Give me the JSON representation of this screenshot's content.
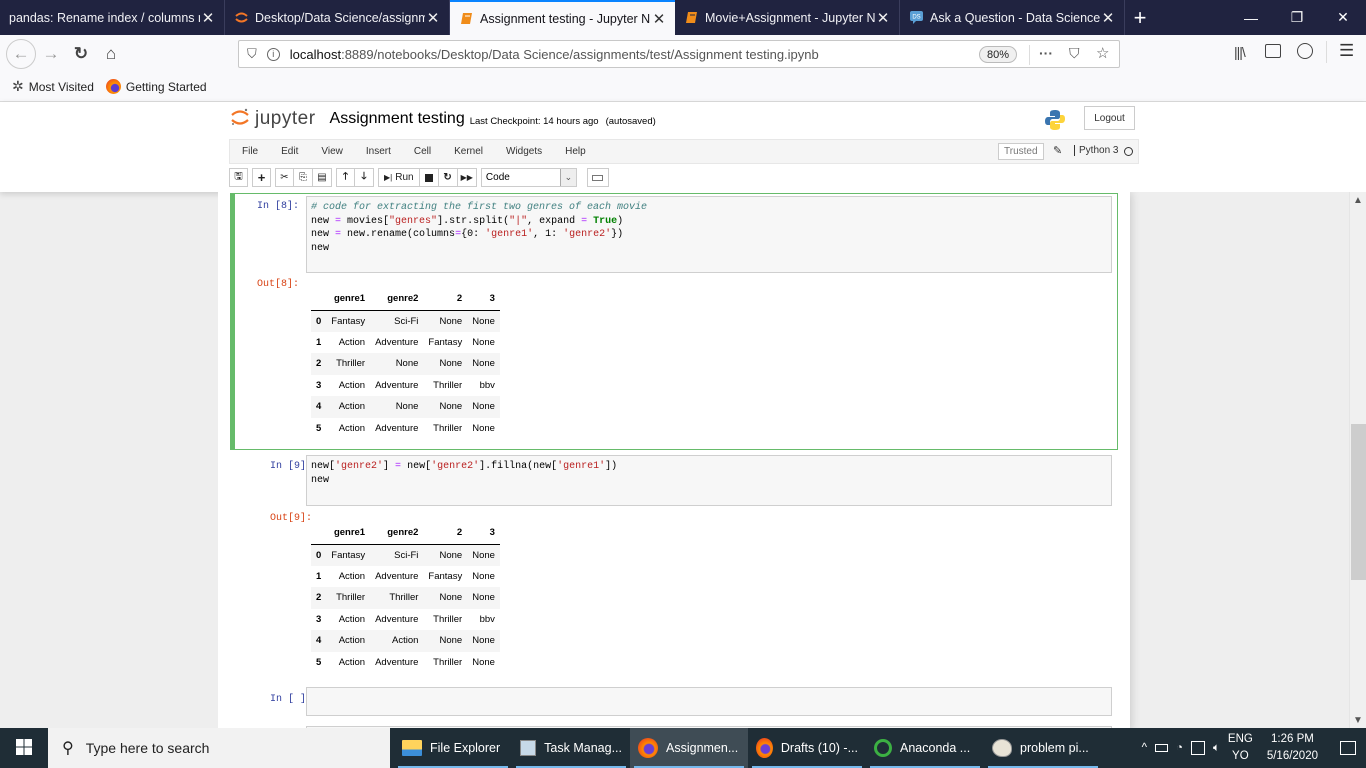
{
  "browser": {
    "tabs": [
      {
        "title": "pandas: Rename index / columns n",
        "icon": "generic-page-icon",
        "active": false
      },
      {
        "title": "Desktop/Data Science/assignm",
        "icon": "jupyter-icon",
        "active": false
      },
      {
        "title": "Assignment testing - Jupyter N",
        "icon": "notebook-icon",
        "active": true
      },
      {
        "title": "Movie+Assignment - Jupyter N",
        "icon": "notebook-icon",
        "active": false
      },
      {
        "title": "Ask a Question - Data Science S",
        "icon": "ds-icon",
        "active": false
      }
    ],
    "new_tab": "+",
    "url_host": "localhost",
    "url_rest": ":8889/notebooks/Desktop/Data Science/assignments/test/Assignment testing.ipynb",
    "zoom_level": "80%",
    "bookmarks": [
      {
        "label": "Most Visited",
        "icon": "gear-icon"
      },
      {
        "label": "Getting Started",
        "icon": "firefox-icon"
      }
    ]
  },
  "jupyter": {
    "logo_text": "jupyter",
    "notebook_name": "Assignment testing",
    "checkpoint": "Last Checkpoint: 14 hours ago",
    "autosaved": "(autosaved)",
    "logout": "Logout",
    "menu": [
      "File",
      "Edit",
      "View",
      "Insert",
      "Cell",
      "Kernel",
      "Widgets",
      "Help"
    ],
    "trusted": "Trusted",
    "kernel_name": "Python 3",
    "run_label": "Run",
    "cell_type": "Code"
  },
  "cells": [
    {
      "in_prompt": "In [8]:",
      "out_prompt": "Out[8]:",
      "table": {
        "columns": [
          "",
          "genre1",
          "genre2",
          "2",
          "3"
        ],
        "rows": [
          [
            "0",
            "Fantasy",
            "Sci-Fi",
            "None",
            "None"
          ],
          [
            "1",
            "Action",
            "Adventure",
            "Fantasy",
            "None"
          ],
          [
            "2",
            "Thriller",
            "None",
            "None",
            "None"
          ],
          [
            "3",
            "Action",
            "Adventure",
            "Thriller",
            "bbv"
          ],
          [
            "4",
            "Action",
            "None",
            "None",
            "None"
          ],
          [
            "5",
            "Action",
            "Adventure",
            "Thriller",
            "None"
          ]
        ]
      }
    },
    {
      "in_prompt": "In [9]:",
      "out_prompt": "Out[9]:",
      "table": {
        "columns": [
          "",
          "genre1",
          "genre2",
          "2",
          "3"
        ],
        "rows": [
          [
            "0",
            "Fantasy",
            "Sci-Fi",
            "None",
            "None"
          ],
          [
            "1",
            "Action",
            "Adventure",
            "Fantasy",
            "None"
          ],
          [
            "2",
            "Thriller",
            "Thriller",
            "None",
            "None"
          ],
          [
            "3",
            "Action",
            "Adventure",
            "Thriller",
            "bbv"
          ],
          [
            "4",
            "Action",
            "Action",
            "None",
            "None"
          ],
          [
            "5",
            "Action",
            "Adventure",
            "Thriller",
            "None"
          ]
        ]
      }
    },
    {
      "in_prompt": "In [ ]:"
    }
  ],
  "code": {
    "c8_l1": "# code for extracting the first two genres of each movie",
    "c8_l2a": "new ",
    "c8_eq": "=",
    "c8_l2b": " movies[",
    "c8_s1": "\"genres\"",
    "c8_l2c": "].str.split(",
    "c8_s2": "\"|\"",
    "c8_l2d": ", expand ",
    "c8_eq2": "=",
    "c8_sp": " ",
    "c8_true": "True",
    "c8_l2e": ")",
    "c8_l3a": "new ",
    "c8_eq3": "=",
    "c8_l3b": " new.rename(columns",
    "c8_eq4": "=",
    "c8_l3c": "{0: ",
    "c8_s3": "'genre1'",
    "c8_l3d": ", 1: ",
    "c8_s4": "'genre2'",
    "c8_l3e": "})",
    "c8_l4": "new",
    "c9_l1a": "new[",
    "c9_s1": "'genre2'",
    "c9_l1b": "] ",
    "c9_eq": "=",
    "c9_l1c": " new[",
    "c9_s2": "'genre2'",
    "c9_l1d": "].fillna(new[",
    "c9_s3": "'genre1'",
    "c9_l1e": "])",
    "c9_l2": "new"
  },
  "scrollbar": {
    "position_fraction": 0.62,
    "visible_fraction": 0.31
  },
  "taskbar": {
    "search_placeholder": "Type here to search",
    "apps": [
      {
        "label": "File Explorer",
        "icon": "folder-icon",
        "active": false
      },
      {
        "label": "Task Manag...",
        "icon": "task-manager-icon",
        "active": false
      },
      {
        "label": "Assignmen...",
        "icon": "firefox-icon",
        "active": true
      },
      {
        "label": "Drafts (10) -...",
        "icon": "firefox-icon",
        "active": false
      },
      {
        "label": "Anaconda ...",
        "icon": "anaconda-icon",
        "active": false
      },
      {
        "label": "problem pi...",
        "icon": "paint-icon",
        "active": false
      }
    ],
    "lang_top": "ENG",
    "lang_bottom": "YO",
    "time": "1:26 PM",
    "date": "5/16/2020"
  },
  "colors": {
    "selected_cell_border": "#66bb6a",
    "in_prompt": "#303f9f",
    "out_prompt": "#d84315",
    "tab_active_accent": "#0a84ff"
  }
}
